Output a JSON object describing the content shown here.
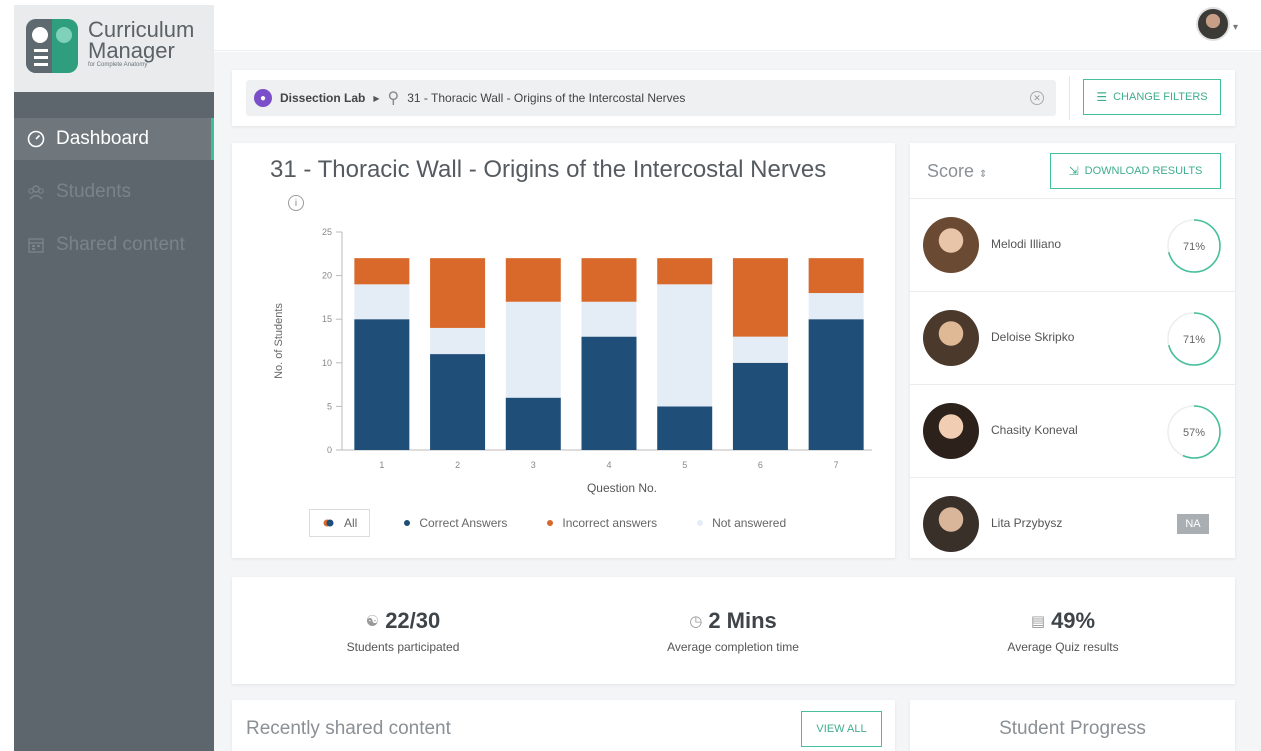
{
  "app": {
    "logo_line1": "Curriculum",
    "logo_line2": "Manager",
    "logo_sub": "for Complete Anatomy"
  },
  "sidebar": {
    "items": [
      {
        "label": "Dashboard",
        "icon": "dashboard-gauge-icon",
        "active": true
      },
      {
        "label": "Students",
        "icon": "students-group-icon",
        "active": false
      },
      {
        "label": "Shared content",
        "icon": "calendar-icon",
        "active": false
      }
    ]
  },
  "filter": {
    "lab": "Dissection Lab",
    "query": "31 - Thoracic Wall - Origins of the Intercostal Nerves",
    "change_filters_label": "CHANGE FILTERS"
  },
  "chart_card": {
    "title": "31 - Thoracic Wall - Origins of the Intercostal Nerves"
  },
  "chart_data": {
    "type": "bar",
    "stacked": true,
    "categories": [
      "1",
      "2",
      "3",
      "4",
      "5",
      "6",
      "7"
    ],
    "series": [
      {
        "name": "Correct Answers",
        "color": "#1f4e79",
        "values": [
          15,
          11,
          6,
          13,
          5,
          10,
          15
        ]
      },
      {
        "name": "Not answered",
        "color": "#e4edf5",
        "values": [
          4,
          3,
          11,
          4,
          14,
          3,
          3
        ]
      },
      {
        "name": "Incorrect answers",
        "color": "#d9692a",
        "values": [
          3,
          8,
          5,
          5,
          3,
          9,
          4
        ]
      }
    ],
    "xlabel": "Question No.",
    "ylabel": "No. of Students",
    "ylim": [
      0,
      25
    ],
    "yticks": [
      0,
      5,
      10,
      15,
      20,
      25
    ],
    "legend": {
      "all_label": "All",
      "items": [
        {
          "label": "Correct Answers",
          "color": "#1f4e79"
        },
        {
          "label": "Incorrect answers",
          "color": "#d9692a"
        },
        {
          "label": "Not answered",
          "color": "#e4edf5"
        }
      ]
    }
  },
  "score": {
    "label": "Score",
    "sort_icon": "sort-icon",
    "download_label": "DOWNLOAD RESULTS",
    "students": [
      {
        "name": "Melodi Illiano",
        "score": "71%",
        "pct": 71
      },
      {
        "name": "Deloise Skripko",
        "score": "71%",
        "pct": 71
      },
      {
        "name": "Chasity Koneval",
        "score": "57%",
        "pct": 57
      },
      {
        "name": "Lita Przybysz",
        "score": "NA",
        "pct": null
      }
    ]
  },
  "stats": [
    {
      "value": "22/30",
      "label": "Students participated",
      "icon": "students-group-icon"
    },
    {
      "value": "2 Mins",
      "label": "Average completion time",
      "icon": "clock-icon"
    },
    {
      "value": "49%",
      "label": "Average Quiz results",
      "icon": "document-icon"
    }
  ],
  "recent": {
    "title": "Recently shared content",
    "view_all_label": "VIEW ALL"
  },
  "progress": {
    "title": "Student Progress"
  }
}
